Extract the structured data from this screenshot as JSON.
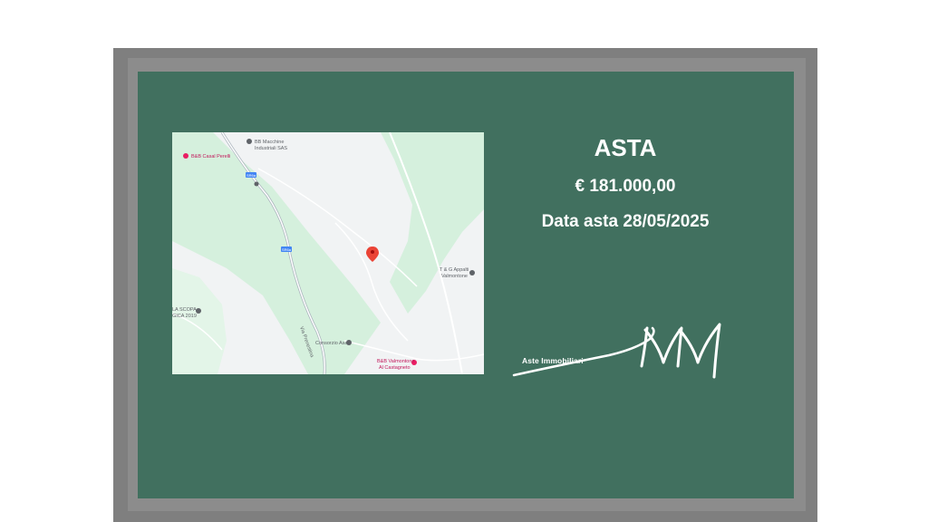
{
  "listing": {
    "title": "ASTA",
    "price": "€  181.000,00",
    "auction_date": "Data asta 28/05/2025"
  },
  "logo": {
    "monogram": "MM",
    "caption": "Aste Immobiliari"
  },
  "map": {
    "labels": {
      "bb_macchine": "BB Macchine",
      "bb_macchine_2": "Industriali SAS",
      "bb_casal": "B&B Casal Perelli",
      "appalti": "T & G Appalti",
      "appalti_2": "Valmontone",
      "la_scopa": "LA SCOPA",
      "la_scopa_2": "GICA 2019",
      "consorzio": "Consorzio Asa",
      "bb_valmontone": "B&B Valmontone",
      "bb_valmontone_2": "Al Castagneto",
      "via_prenestina": "Via Prenestina",
      "road_badge_a": "SR6a",
      "road_badge_b": "SR6a"
    },
    "pin_color": "#ea4335",
    "park_color": "#d5f0dd"
  },
  "colors": {
    "panel": "#41705f",
    "frame": "#7f7f7f"
  }
}
